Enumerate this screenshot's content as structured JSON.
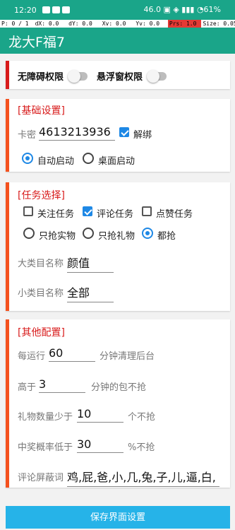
{
  "status": {
    "time": "12:20",
    "right": "46.0 ▣ ◈ ▮▮▮ ◔61%"
  },
  "debug": {
    "p": "P: 0 / 1",
    "dx": "dX: 0.0",
    "dy": "dY: 0.0",
    "xv": "Xv: 0.0",
    "yv": "Yv: 0.0",
    "prs": "Prs: 1.0",
    "size": "Size: 0.05"
  },
  "app": {
    "title": "龙大F福7"
  },
  "permissions": {
    "accessibility": "无障碍权限",
    "overlay": "悬浮窗权限"
  },
  "basic": {
    "title": "[基础设置]",
    "card_label": "卡密",
    "card_value": "4613213936",
    "unbind": "解绑",
    "auto_start": "自动启动",
    "desktop_start": "桌面启动"
  },
  "task": {
    "title": "[任务选择]",
    "follow": "关注任务",
    "comment": "评论任务",
    "like": "点赞任务",
    "only_goods": "只抢实物",
    "only_gifts": "只抢礼物",
    "all": "都抢",
    "major_label": "大类目名称",
    "major_value": "颜值",
    "minor_label": "小类目名称",
    "minor_value": "全部"
  },
  "other": {
    "title": "[其他配置]",
    "run_prefix": "每运行",
    "run_value": "60",
    "run_suffix": "分钟清理后台",
    "above_prefix": "高于",
    "above_value": "3",
    "above_suffix": "分钟的包不抢",
    "gift_prefix": "礼物数量少于",
    "gift_value": "10",
    "gift_suffix": "个不抢",
    "prob_prefix": "中奖概率低于",
    "prob_value": "30",
    "prob_suffix": "%不抢",
    "block_label": "评论屏蔽词",
    "block_value": "鸡,屁,爸,小,几,兔,子,儿,逼,白,"
  },
  "save": {
    "label": "保存界面设置"
  }
}
